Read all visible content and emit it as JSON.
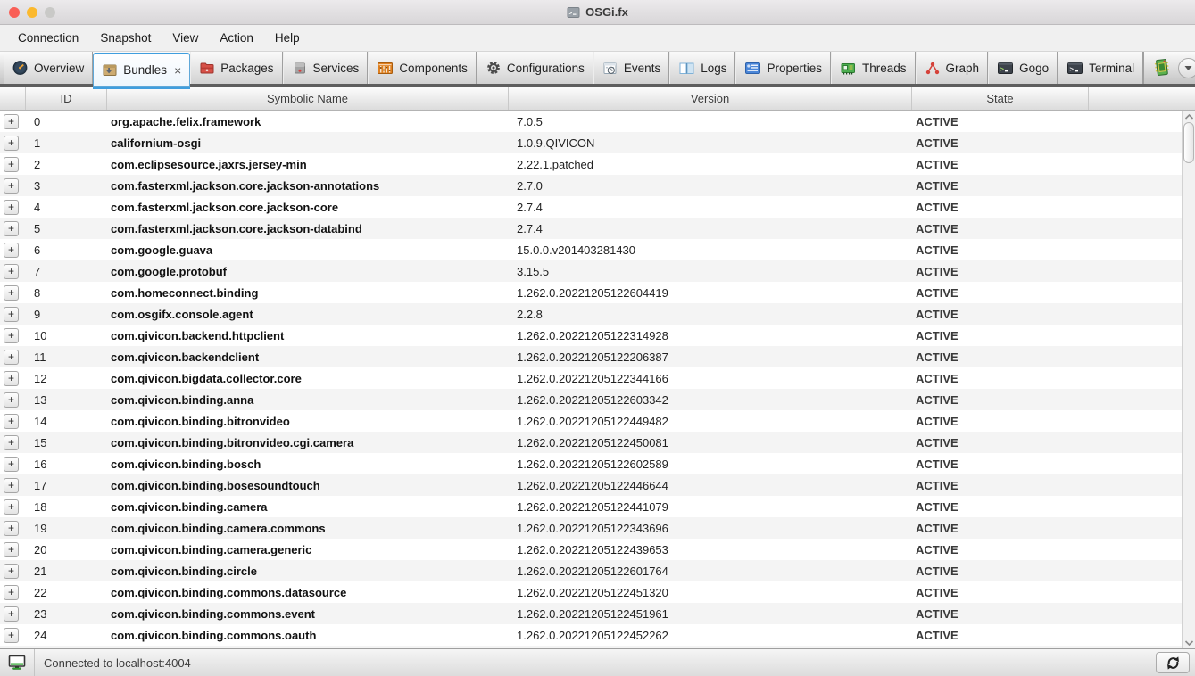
{
  "window": {
    "title": "OSGi.fx"
  },
  "traffic_lights": {
    "red": "#f95f57",
    "yellow": "#fbb92e",
    "disabled": "#c9c9c7"
  },
  "menu": {
    "items": [
      "Connection",
      "Snapshot",
      "View",
      "Action",
      "Help"
    ]
  },
  "tabbar": {
    "close_label": "×",
    "tabs": [
      {
        "label": "Overview",
        "icon": "overview-gauge-icon",
        "active": false
      },
      {
        "label": "Bundles",
        "icon": "bundles-package-icon",
        "active": true,
        "closable": true
      },
      {
        "label": "Packages",
        "icon": "packages-folder-icon",
        "active": false
      },
      {
        "label": "Services",
        "icon": "services-box-icon",
        "active": false
      },
      {
        "label": "Components",
        "icon": "components-abacus-icon",
        "active": false
      },
      {
        "label": "Configurations",
        "icon": "configurations-gear-icon",
        "active": false
      },
      {
        "label": "Events",
        "icon": "events-calendar-icon",
        "active": false
      },
      {
        "label": "Logs",
        "icon": "logs-book-icon",
        "active": false
      },
      {
        "label": "Properties",
        "icon": "properties-list-icon",
        "active": false
      },
      {
        "label": "Threads",
        "icon": "threads-card-icon",
        "active": false
      },
      {
        "label": "Graph",
        "icon": "graph-nodes-icon",
        "active": false
      },
      {
        "label": "Gogo",
        "icon": "gogo-terminal-icon",
        "active": false
      },
      {
        "label": "Terminal",
        "icon": "terminal-icon",
        "active": false
      }
    ]
  },
  "table": {
    "expander_label": "+",
    "columns": [
      {
        "key": "expander",
        "label": ""
      },
      {
        "key": "id",
        "label": "ID"
      },
      {
        "key": "name",
        "label": "Symbolic Name"
      },
      {
        "key": "version",
        "label": "Version"
      },
      {
        "key": "state",
        "label": "State"
      },
      {
        "key": "filler",
        "label": ""
      }
    ],
    "rows": [
      {
        "id": "0",
        "name": "org.apache.felix.framework",
        "version": "7.0.5",
        "state": "ACTIVE"
      },
      {
        "id": "1",
        "name": "californium-osgi",
        "version": "1.0.9.QIVICON",
        "state": "ACTIVE"
      },
      {
        "id": "2",
        "name": "com.eclipsesource.jaxrs.jersey-min",
        "version": "2.22.1.patched",
        "state": "ACTIVE"
      },
      {
        "id": "3",
        "name": "com.fasterxml.jackson.core.jackson-annotations",
        "version": "2.7.0",
        "state": "ACTIVE"
      },
      {
        "id": "4",
        "name": "com.fasterxml.jackson.core.jackson-core",
        "version": "2.7.4",
        "state": "ACTIVE"
      },
      {
        "id": "5",
        "name": "com.fasterxml.jackson.core.jackson-databind",
        "version": "2.7.4",
        "state": "ACTIVE"
      },
      {
        "id": "6",
        "name": "com.google.guava",
        "version": "15.0.0.v201403281430",
        "state": "ACTIVE"
      },
      {
        "id": "7",
        "name": "com.google.protobuf",
        "version": "3.15.5",
        "state": "ACTIVE"
      },
      {
        "id": "8",
        "name": "com.homeconnect.binding",
        "version": "1.262.0.20221205122604419",
        "state": "ACTIVE"
      },
      {
        "id": "9",
        "name": "com.osgifx.console.agent",
        "version": "2.2.8",
        "state": "ACTIVE"
      },
      {
        "id": "10",
        "name": "com.qivicon.backend.httpclient",
        "version": "1.262.0.20221205122314928",
        "state": "ACTIVE"
      },
      {
        "id": "11",
        "name": "com.qivicon.backendclient",
        "version": "1.262.0.20221205122206387",
        "state": "ACTIVE"
      },
      {
        "id": "12",
        "name": "com.qivicon.bigdata.collector.core",
        "version": "1.262.0.20221205122344166",
        "state": "ACTIVE"
      },
      {
        "id": "13",
        "name": "com.qivicon.binding.anna",
        "version": "1.262.0.20221205122603342",
        "state": "ACTIVE"
      },
      {
        "id": "14",
        "name": "com.qivicon.binding.bitronvideo",
        "version": "1.262.0.20221205122449482",
        "state": "ACTIVE"
      },
      {
        "id": "15",
        "name": "com.qivicon.binding.bitronvideo.cgi.camera",
        "version": "1.262.0.20221205122450081",
        "state": "ACTIVE"
      },
      {
        "id": "16",
        "name": "com.qivicon.binding.bosch",
        "version": "1.262.0.20221205122602589",
        "state": "ACTIVE"
      },
      {
        "id": "17",
        "name": "com.qivicon.binding.bosesoundtouch",
        "version": "1.262.0.20221205122446644",
        "state": "ACTIVE"
      },
      {
        "id": "18",
        "name": "com.qivicon.binding.camera",
        "version": "1.262.0.20221205122441079",
        "state": "ACTIVE"
      },
      {
        "id": "19",
        "name": "com.qivicon.binding.camera.commons",
        "version": "1.262.0.20221205122343696",
        "state": "ACTIVE"
      },
      {
        "id": "20",
        "name": "com.qivicon.binding.camera.generic",
        "version": "1.262.0.20221205122439653",
        "state": "ACTIVE"
      },
      {
        "id": "21",
        "name": "com.qivicon.binding.circle",
        "version": "1.262.0.20221205122601764",
        "state": "ACTIVE"
      },
      {
        "id": "22",
        "name": "com.qivicon.binding.commons.datasource",
        "version": "1.262.0.20221205122451320",
        "state": "ACTIVE"
      },
      {
        "id": "23",
        "name": "com.qivicon.binding.commons.event",
        "version": "1.262.0.20221205122451961",
        "state": "ACTIVE"
      },
      {
        "id": "24",
        "name": "com.qivicon.binding.commons.oauth",
        "version": "1.262.0.20221205122452262",
        "state": "ACTIVE"
      }
    ]
  },
  "statusbar": {
    "connection_text": "Connected to localhost:4004"
  },
  "colors": {
    "accent_blue": "#3f9ede"
  }
}
